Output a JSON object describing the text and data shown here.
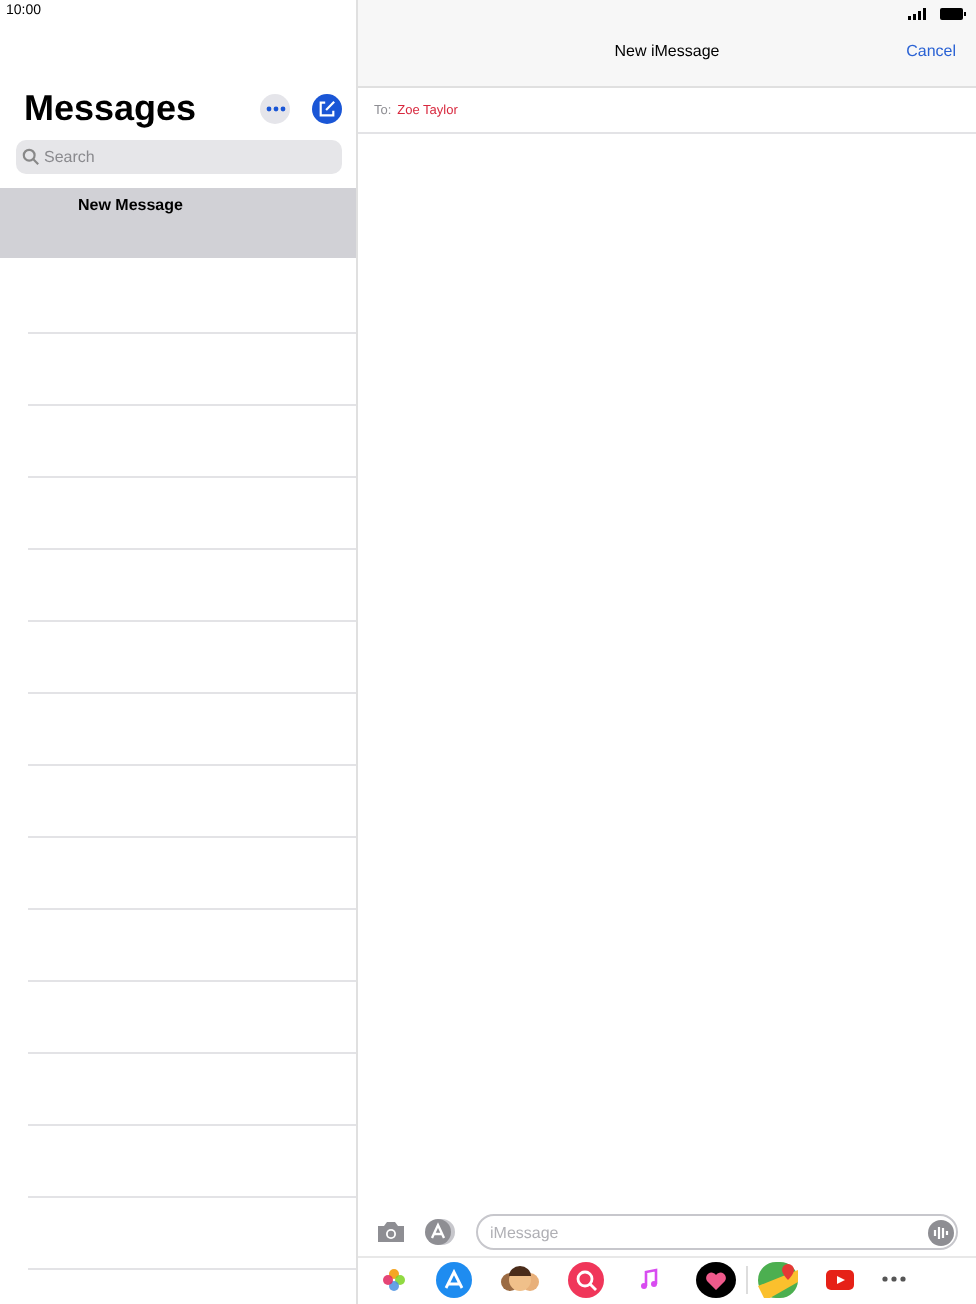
{
  "status_bar": {
    "time": "10:00"
  },
  "sidebar": {
    "title": "Messages",
    "search": {
      "placeholder": "Search"
    },
    "conversations": [
      {
        "name": "New Message",
        "selected": true
      }
    ]
  },
  "compose": {
    "title": "New iMessage",
    "cancel": "Cancel",
    "to_label": "To:",
    "recipient": "Zoe Taylor",
    "message": {
      "placeholder": "iMessage"
    }
  }
}
